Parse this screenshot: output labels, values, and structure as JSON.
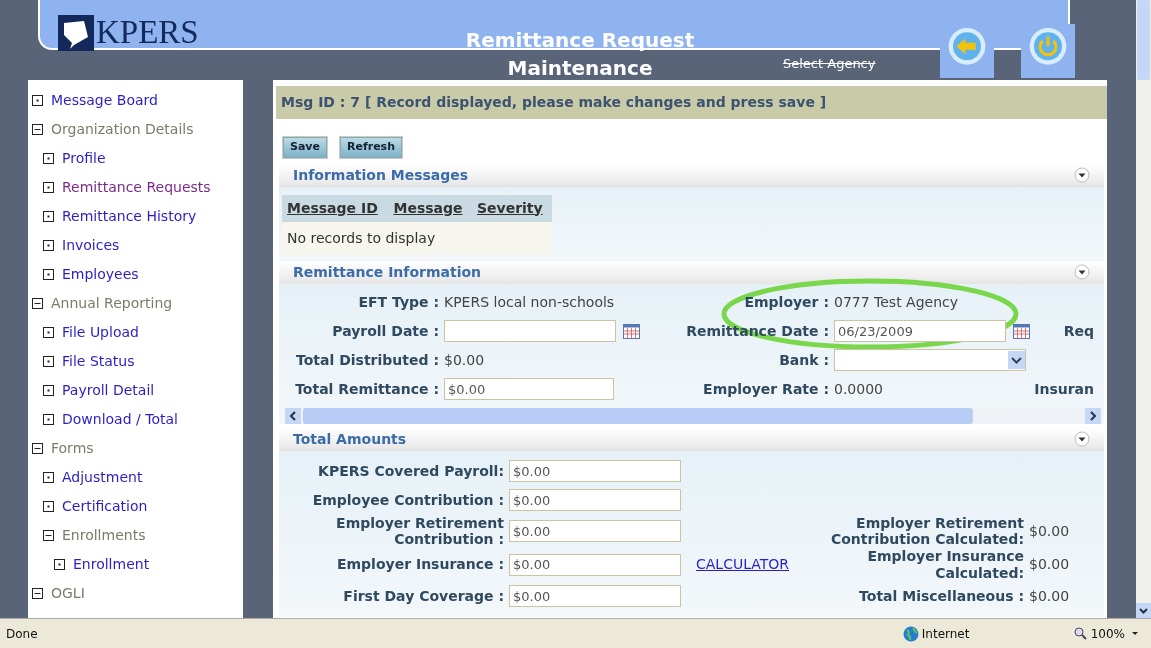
{
  "header": {
    "logo": "KPERS",
    "title": "Remittance Request Maintenance",
    "agency_link": "Select Agency"
  },
  "sidebar": {
    "items": [
      {
        "label": "Message Board",
        "kind": "link",
        "selected": false
      },
      {
        "label": "Organization Details",
        "kind": "group",
        "expanded": true,
        "children": [
          {
            "label": "Profile",
            "kind": "link",
            "selected": false
          },
          {
            "label": "Remittance Requests",
            "kind": "link",
            "selected": true
          },
          {
            "label": "Remittance History",
            "kind": "link",
            "selected": false
          },
          {
            "label": "Invoices",
            "kind": "link",
            "selected": false
          },
          {
            "label": "Employees",
            "kind": "link",
            "selected": false
          }
        ]
      },
      {
        "label": "Annual Reporting",
        "kind": "group",
        "expanded": true,
        "children": [
          {
            "label": "File Upload",
            "kind": "link",
            "selected": false
          },
          {
            "label": "File Status",
            "kind": "link",
            "selected": false
          },
          {
            "label": "Payroll Detail",
            "kind": "link",
            "selected": false
          },
          {
            "label": "Download / Total",
            "kind": "link",
            "selected": false
          }
        ]
      },
      {
        "label": "Forms",
        "kind": "group",
        "expanded": true,
        "children": [
          {
            "label": "Adjustment",
            "kind": "link",
            "selected": false
          },
          {
            "label": "Certification",
            "kind": "link",
            "selected": false
          },
          {
            "label": "Enrollments",
            "kind": "group",
            "expanded": true,
            "children": [
              {
                "label": "Enrollment",
                "kind": "link",
                "selected": false
              }
            ]
          }
        ]
      },
      {
        "label": "OGLI",
        "kind": "group",
        "expanded": true
      }
    ]
  },
  "message_bar": "Msg ID : 7 [ Record displayed, please make changes and press save ]",
  "buttons": [
    "Save",
    "Refresh"
  ],
  "information_messages": {
    "title": "Information Messages",
    "columns": [
      "Message ID",
      "Message",
      "Severity"
    ],
    "empty_text": "No records to display"
  },
  "remittance_information": {
    "title": "Remittance Information",
    "rows": [
      [
        {
          "label": "EFT Type :",
          "kind": "text",
          "value": "KPERS local non-schools"
        },
        {
          "label": "Employer :",
          "kind": "text",
          "value": "0777 Test Agency"
        }
      ],
      [
        {
          "label": "Payroll Date :",
          "kind": "date"
        },
        {
          "label": "Remittance Date :",
          "kind": "date",
          "value": "06/23/2009"
        },
        {
          "label": "Req",
          "kind": "label"
        }
      ],
      [
        {
          "label": "Total Distributed :",
          "kind": "text",
          "value": "$0.00"
        },
        {
          "label": "Bank :",
          "kind": "select"
        }
      ],
      [
        {
          "label": "Total Remittance :",
          "kind": "input",
          "value": "$0.00"
        },
        {
          "label": "Employer Rate :",
          "kind": "text",
          "value": "0.0000"
        },
        {
          "label": "Insuran",
          "kind": "label"
        }
      ]
    ]
  },
  "total_amounts": {
    "title": "Total Amounts",
    "rows": [
      {
        "label": "KPERS Covered Payroll:",
        "value": "$0.00"
      },
      {
        "label": "Employee Contribution :",
        "value": "$0.00"
      },
      {
        "label": "Employer Retirement Contribution :",
        "value": "$0.00",
        "calc_label": "Employer Retirement Contribution Calculated:",
        "calc_value": "$0.00"
      },
      {
        "label": "Employer Insurance :",
        "value": "$0.00",
        "link": "CALCULATOR",
        "calc_label": "Employer Insurance Calculated:",
        "calc_value": "$0.00"
      },
      {
        "label": "First Day Coverage :",
        "value": "$0.00",
        "calc_label": "Total Miscellaneous :",
        "calc_value": "$0.00"
      }
    ]
  },
  "status_bar": {
    "status": "Done",
    "zone": "Internet",
    "zoom": "100%"
  }
}
